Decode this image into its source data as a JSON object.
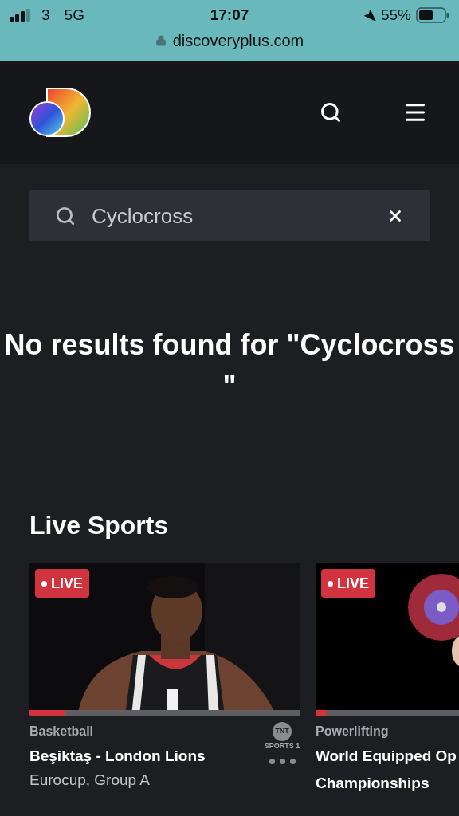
{
  "status_bar": {
    "carrier": "3",
    "network": "5G",
    "time": "17:07",
    "battery": "55%"
  },
  "address_bar": {
    "url": "discoveryplus.com"
  },
  "search": {
    "value": "Cyclocross"
  },
  "message": "No results found for \"Cyclocross \"",
  "section": {
    "title": "Live Sports",
    "cards": [
      {
        "badge": "LIVE",
        "level": 0.13,
        "category": "Basketball",
        "title_lines": [
          "Beşiktaş - London Lions"
        ],
        "subtitle": "Eurocup, Group A",
        "channel": {
          "logo": "TNT",
          "name": "SPORTS 1"
        },
        "kind": "basketball"
      },
      {
        "badge": "LIVE",
        "level": 0.04,
        "category": "Powerlifting",
        "title_lines": [
          "World Equipped Op",
          "Championships"
        ],
        "kind": "powerlifting"
      }
    ]
  }
}
